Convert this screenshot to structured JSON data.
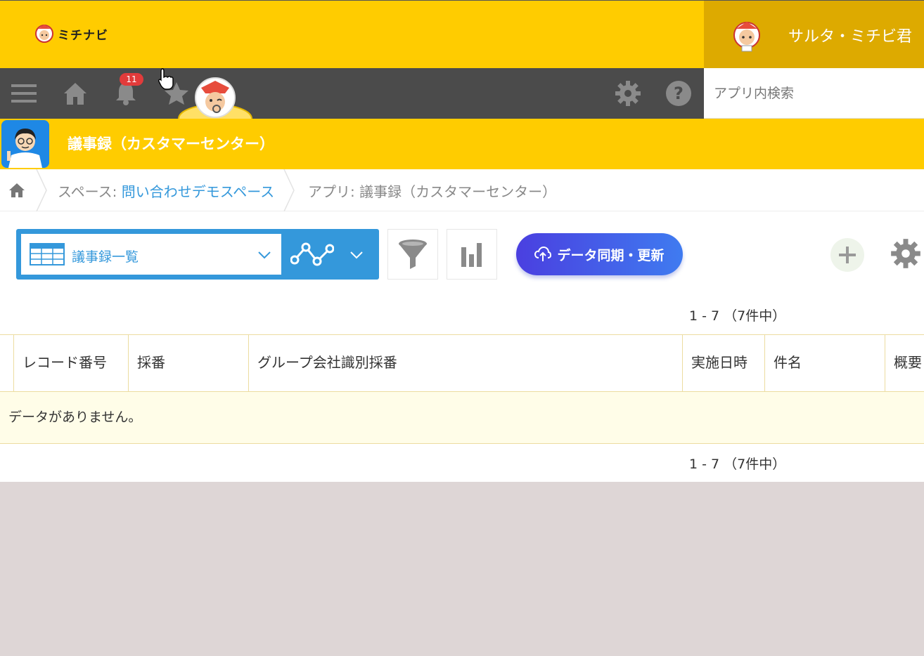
{
  "header": {
    "logo_text": "ミチナビ",
    "user_name": "サルタ・ミチビ君"
  },
  "nav": {
    "menu_icon": "hamburger-icon",
    "home_icon": "home-icon",
    "bell_icon": "bell-icon",
    "notification_count": "11",
    "star_icon": "star-icon",
    "settings_icon": "gear-icon",
    "help_icon": "help-icon",
    "search_placeholder": "アプリ内検索"
  },
  "app": {
    "title": "議事録（カスタマーセンター）"
  },
  "breadcrumb": {
    "space_prefix": "スペース: ",
    "space_link": "問い合わせデモスペース",
    "app_crumb": "アプリ: 議事録（カスタマーセンター）"
  },
  "toolbar": {
    "view_name": "議事録一覧",
    "sync_label": "データ同期・更新"
  },
  "pager": {
    "range": "1 - 7 （7件中）"
  },
  "table": {
    "columns": [
      "レコード番号",
      "採番",
      "グループ会社識別採番",
      "実施日時",
      "件名",
      "概要"
    ],
    "empty_message": "データがありません。"
  },
  "colors": {
    "brand_yellow": "#ffcc00",
    "nav_dark": "#4b4b4b",
    "accent_blue": "#3498db",
    "badge_red": "#e23b3b"
  }
}
